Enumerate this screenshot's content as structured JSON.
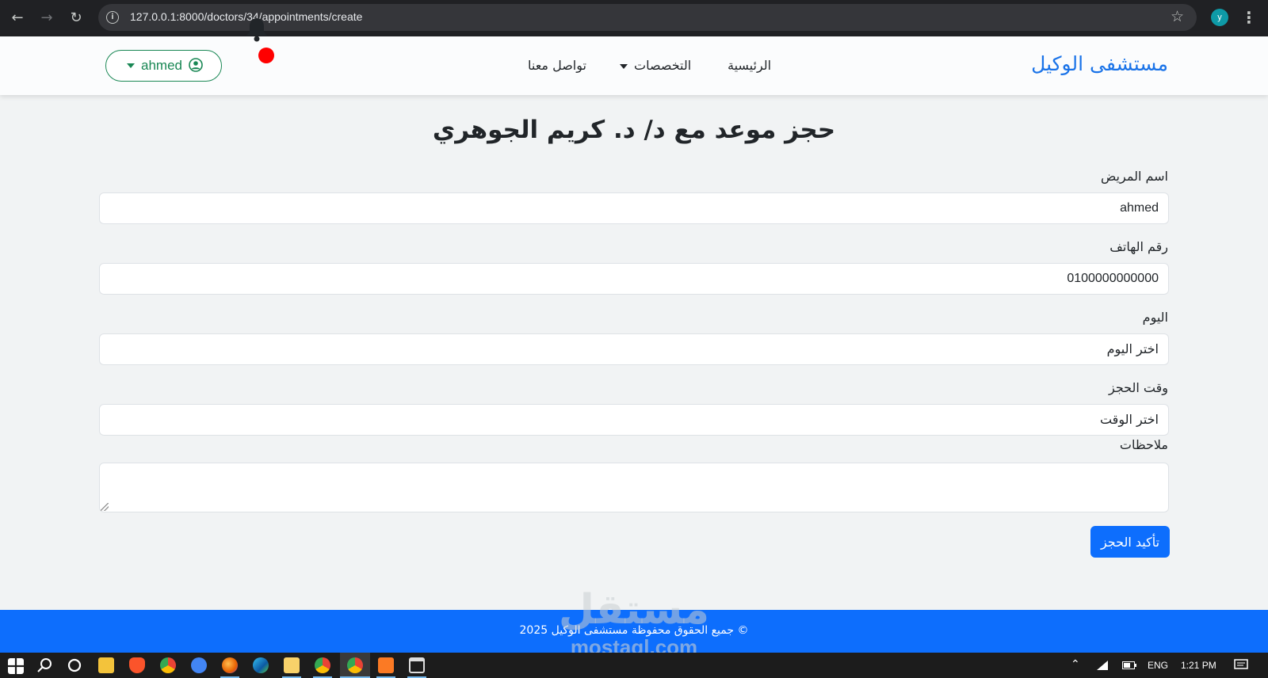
{
  "browser": {
    "url": "127.0.0.1:8000/doctors/34/appointments/create",
    "profile_initial": "y"
  },
  "navbar": {
    "brand": "مستشفى الوكيل",
    "links": [
      {
        "label": "الرئيسية"
      },
      {
        "label": "التخصصات",
        "dropdown": true
      },
      {
        "label": "تواصل معنا"
      }
    ],
    "user_name": "ahmed",
    "notification_dot_color": "#ff0000"
  },
  "page": {
    "title": "حجز موعد مع د/ د. كريم الجوهري"
  },
  "form": {
    "patient_name_label": "اسم المريض",
    "patient_name_value": "ahmed",
    "phone_label": "رقم الهاتف",
    "phone_value": "0100000000000",
    "day_label": "اليوم",
    "day_selected": "اختر اليوم",
    "time_label": "وقت الحجز",
    "time_selected": "اختر الوقت",
    "notes_label": "ملاحظات",
    "notes_value": "",
    "submit_label": "تأكيد الحجز"
  },
  "footer": {
    "text": "© جميع الحقوق محفوظة مستشفى الوكيل 2025"
  },
  "watermark": {
    "arabic": "مستقل",
    "latin": "mostaql.com"
  },
  "taskbar": {
    "language": "ENG",
    "time": "1:21 PM"
  },
  "colors": {
    "brand": "#1a73e8",
    "primary": "#0d6efd",
    "success": "#198754"
  }
}
